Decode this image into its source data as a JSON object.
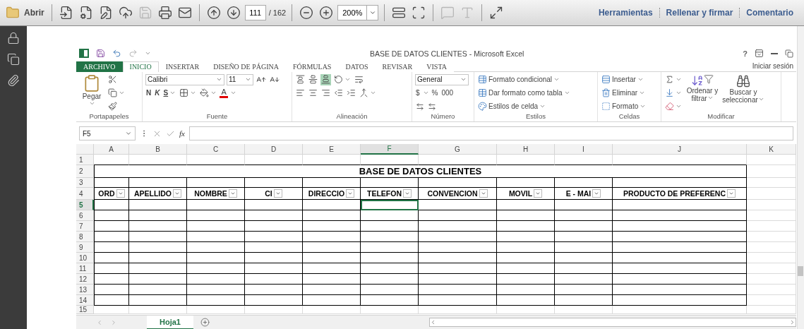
{
  "viewer": {
    "open_label": "Abrir",
    "tool_groups": [
      [
        {
          "kind": "create",
          "disabled": false
        },
        {
          "kind": "combine",
          "disabled": false
        },
        {
          "kind": "edit",
          "disabled": false
        },
        {
          "kind": "upload",
          "disabled": false
        },
        {
          "kind": "save",
          "disabled": true
        },
        {
          "kind": "print",
          "disabled": false
        },
        {
          "kind": "mail",
          "disabled": false
        }
      ],
      [
        {
          "kind": "prev",
          "disabled": false
        },
        {
          "kind": "next",
          "disabled": false
        }
      ],
      [
        {
          "kind": "zoom-out",
          "disabled": false
        },
        {
          "kind": "zoom-in",
          "disabled": false
        }
      ],
      [
        {
          "kind": "fit-width",
          "disabled": false
        },
        {
          "kind": "fit-page",
          "disabled": false
        }
      ],
      [
        {
          "kind": "comment",
          "disabled": true
        },
        {
          "kind": "annotate",
          "disabled": true
        }
      ],
      [
        {
          "kind": "fullscreen",
          "disabled": false
        }
      ]
    ],
    "page": {
      "current": "111",
      "total": "/ 162"
    },
    "zoom": "200%",
    "links": [
      "Herramientas",
      "Rellenar y firmar",
      "Comentario"
    ]
  },
  "excel": {
    "title": "BASE DE DATOS CLIENTES - Microsoft Excel",
    "help": "?",
    "tabs": [
      {
        "label": "ARCHIVO",
        "kind": "file",
        "selected": false
      },
      {
        "label": "INICIO",
        "kind": "tab",
        "selected": true
      },
      {
        "label": "INSERTAR",
        "kind": "tab",
        "selected": false
      },
      {
        "label": "DISEÑO DE PÁGINA",
        "kind": "tab",
        "selected": false
      },
      {
        "label": "FÓRMULAS",
        "kind": "tab",
        "selected": false
      },
      {
        "label": "DATOS",
        "kind": "tab",
        "selected": false
      },
      {
        "label": "REVISAR",
        "kind": "tab",
        "selected": false
      },
      {
        "label": "VISTA",
        "kind": "tab",
        "selected": false
      }
    ],
    "account": "Iniciar sesión",
    "ribbon": {
      "clipboard": {
        "paste": "Pegar",
        "label": "Portapapeles"
      },
      "font": {
        "name": "Calibri",
        "size": "11",
        "bold": "N",
        "italic": "K",
        "underline": "S",
        "color_letter": "A",
        "label": "Fuente"
      },
      "alignment": {
        "vertical": [
          {
            "on": false
          },
          {
            "on": false
          },
          {
            "on": true
          }
        ],
        "label": "Alineación"
      },
      "number": {
        "format": "General",
        "currency": "$",
        "percent": "%",
        "thousands": "000",
        "label": "Número"
      },
      "styles": {
        "items": [
          "Formato condicional",
          "Dar formato como tabla",
          "Estilos de celda"
        ],
        "label": "Estilos"
      },
      "cells": {
        "items": [
          "Insertar",
          "Eliminar",
          "Formato"
        ],
        "label": "Celdas"
      },
      "editing": {
        "sort": "Ordenar y filtrar",
        "find": "Buscar y seleccionar",
        "label": "Modificar"
      }
    },
    "formula_bar": {
      "name_box": "F5",
      "fx": "fx"
    },
    "sheet": {
      "title": "BASE DE DATOS CLIENTES",
      "columns": [
        {
          "letter": "A",
          "selected": false
        },
        {
          "letter": "B",
          "selected": false
        },
        {
          "letter": "C",
          "selected": false
        },
        {
          "letter": "D",
          "selected": false
        },
        {
          "letter": "E",
          "selected": false
        },
        {
          "letter": "F",
          "selected": true
        },
        {
          "letter": "G",
          "selected": false
        },
        {
          "letter": "H",
          "selected": false
        },
        {
          "letter": "I",
          "selected": false
        },
        {
          "letter": "J",
          "selected": false
        },
        {
          "letter": "K",
          "selected": false
        }
      ],
      "rows": [
        {
          "number": "1",
          "selected": false
        },
        {
          "number": "2",
          "selected": false
        },
        {
          "number": "3",
          "selected": false
        },
        {
          "number": "4",
          "selected": false
        },
        {
          "number": "5",
          "selected": true
        },
        {
          "number": "6",
          "selected": false
        },
        {
          "number": "7",
          "selected": false
        },
        {
          "number": "8",
          "selected": false
        },
        {
          "number": "9",
          "selected": false
        },
        {
          "number": "10",
          "selected": false
        },
        {
          "number": "11",
          "selected": false
        },
        {
          "number": "12",
          "selected": false
        },
        {
          "number": "13",
          "selected": false
        },
        {
          "number": "14",
          "selected": false
        },
        {
          "number": "15",
          "selected": false
        }
      ],
      "headers": [
        "ORD",
        "APELLIDO",
        "NOMBRE",
        "CI",
        "DIRECCIO",
        "TELEFON",
        "CONVENCION",
        "MOVIL",
        "E - MAI",
        "PRODUCTO DE PREFERENC"
      ]
    },
    "sheet_tabs": [
      {
        "label": "Hoja1",
        "selected": true
      }
    ]
  }
}
